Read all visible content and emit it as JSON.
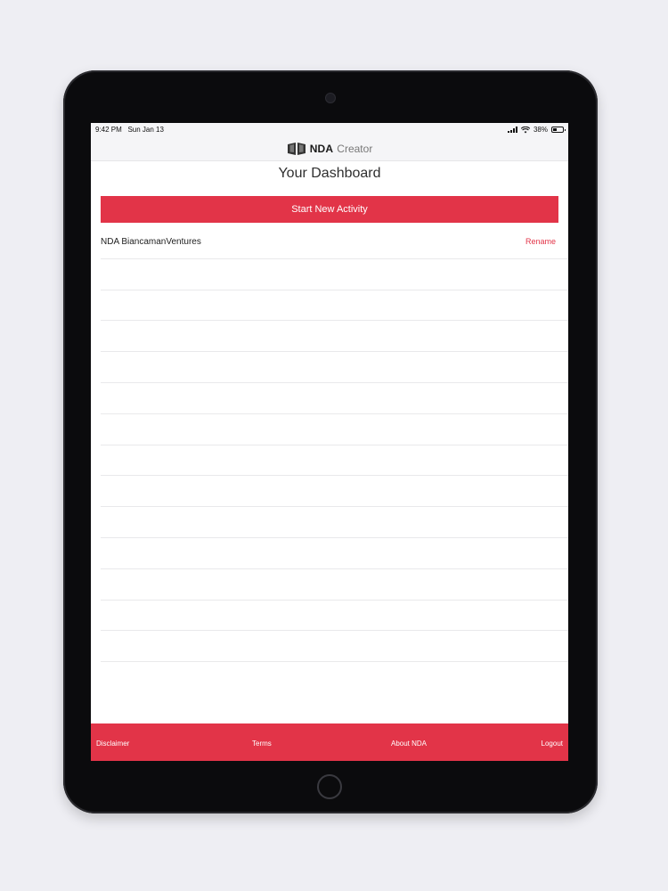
{
  "status_bar": {
    "time": "9:42 PM",
    "date": "Sun Jan 13",
    "battery": "38%",
    "battery_level": 0.38
  },
  "header": {
    "logo_bold": "NDA",
    "logo_light": "Creator",
    "logo_icon": "book-icon"
  },
  "page": {
    "title": "Your Dashboard",
    "primary_button": "Start New Activity"
  },
  "activities": [
    {
      "name": "NDA BiancamanVentures",
      "action": "Rename"
    }
  ],
  "empty_rows": 13,
  "footer": {
    "disclaimer": "Disclaimer",
    "terms": "Terms",
    "about": "About NDA",
    "logout": "Logout"
  },
  "colors": {
    "accent": "#e23448",
    "bezel": "#0b0b0d",
    "background": "#eeeef3"
  }
}
